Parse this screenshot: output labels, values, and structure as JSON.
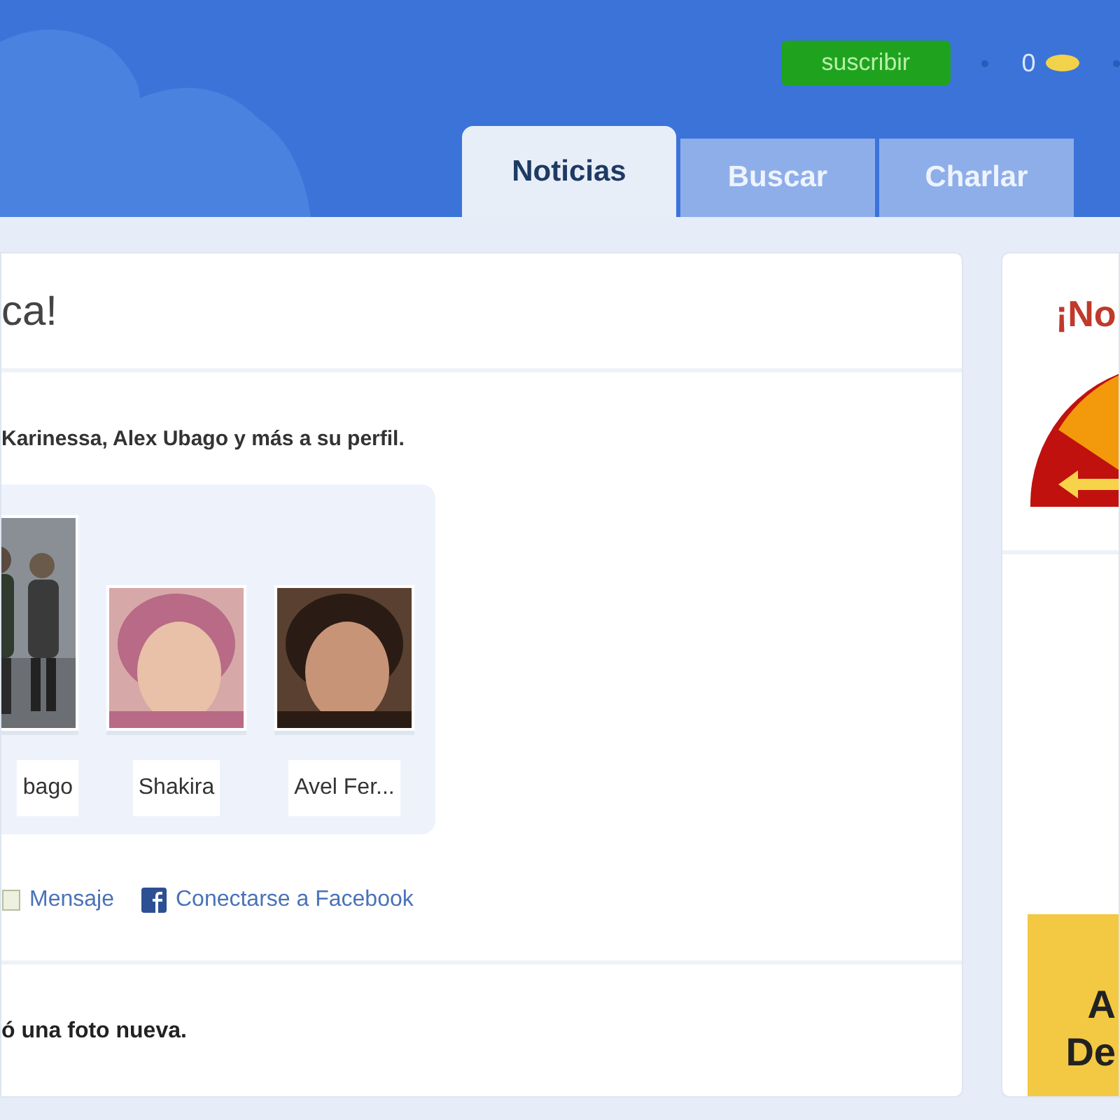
{
  "header": {
    "subscribe_button": "suscribir",
    "coins": "0"
  },
  "tabs": [
    {
      "label": "Noticias",
      "selected": true
    },
    {
      "label": "Buscar",
      "selected": false
    },
    {
      "label": "Charlar",
      "selected": false
    }
  ],
  "main": {
    "title": "ca!",
    "suggestion_text": "Karinessa, Alex Ubago y más a su perfil.",
    "profiles": [
      {
        "name": "bago",
        "kind": "group"
      },
      {
        "name": "Shakira",
        "kind": "portrait"
      },
      {
        "name": "Avel Fer...",
        "kind": "portrait"
      }
    ],
    "links": [
      {
        "label": "Mensaje",
        "kind": "message"
      },
      {
        "label": "Conectarse a Facebook",
        "kind": "facebook"
      }
    ],
    "activity_text": "ó una foto nueva."
  },
  "side": {
    "title": "¡No",
    "promo_lines": [
      "A",
      "De"
    ]
  }
}
